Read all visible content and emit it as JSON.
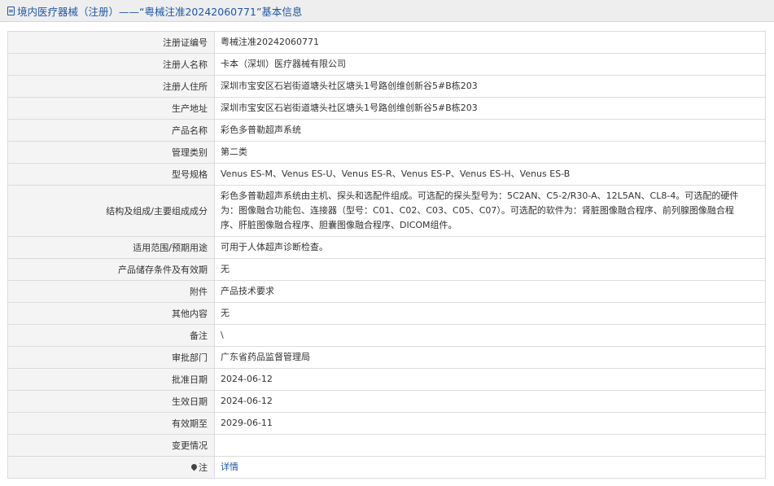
{
  "header": {
    "title": "境内医疗器械（注册）——“粤械注准20242060771”基本信息"
  },
  "rows": [
    {
      "label": "注册证编号",
      "value": "粤械注准20242060771"
    },
    {
      "label": "注册人名称",
      "value": "卡本（深圳）医疗器械有限公司"
    },
    {
      "label": "注册人住所",
      "value": "深圳市宝安区石岩街道塘头社区塘头1号路创维创新谷5#B栋203"
    },
    {
      "label": "生产地址",
      "value": "深圳市宝安区石岩街道塘头社区塘头1号路创维创新谷5#B栋203"
    },
    {
      "label": "产品名称",
      "value": "彩色多普勒超声系统"
    },
    {
      "label": "管理类别",
      "value": "第二类"
    },
    {
      "label": "型号规格",
      "value": "Venus ES-M、Venus ES-U、Venus ES-R、Venus ES-P、Venus ES-H、Venus ES-B"
    },
    {
      "label": "结构及组成/主要组成成分",
      "value": "彩色多普勒超声系统由主机、探头和选配件组成。可选配的探头型号为：5C2AN、C5-2/R30-A、12L5AN、CL8-4。可选配的硬件为：图像融合功能包、连接器（型号：C01、C02、C03、C05、C07）。可选配的软件为：肾脏图像融合程序、前列腺图像融合程序、肝脏图像融合程序、胆囊图像融合程序、DICOM组件。"
    },
    {
      "label": "适用范围/预期用途",
      "value": "可用于人体超声诊断检查。"
    },
    {
      "label": "产品储存条件及有效期",
      "value": "无"
    },
    {
      "label": "附件",
      "value": "产品技术要求"
    },
    {
      "label": "其他内容",
      "value": "无"
    },
    {
      "label": "备注",
      "value": "\\"
    },
    {
      "label": "审批部门",
      "value": "广东省药品监督管理局"
    },
    {
      "label": "批准日期",
      "value": "2024-06-12"
    },
    {
      "label": "生效日期",
      "value": "2024-06-12"
    },
    {
      "label": "有效期至",
      "value": "2029-06-11"
    },
    {
      "label": "变更情况",
      "value": ""
    }
  ],
  "note": {
    "label": "注",
    "link_text": "详情"
  }
}
